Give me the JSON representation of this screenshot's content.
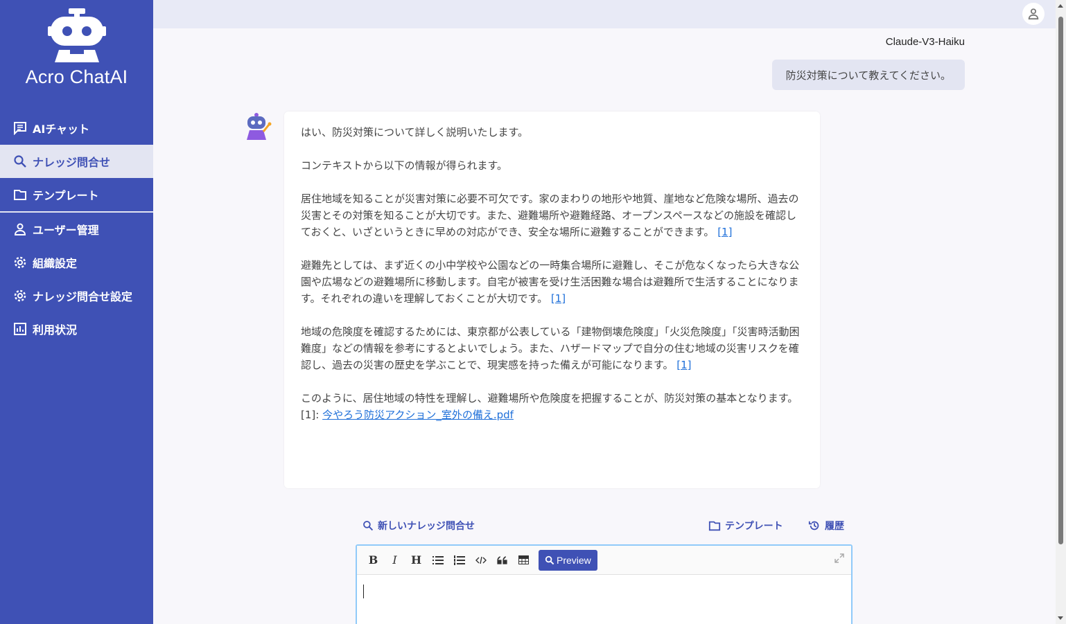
{
  "app": {
    "name": "Acro ChatAI"
  },
  "sidebar": {
    "items": [
      {
        "label": "AIチャット",
        "icon": "chat-icon"
      },
      {
        "label": "ナレッジ問合せ",
        "icon": "search-icon",
        "active": true
      },
      {
        "label": "テンプレート",
        "icon": "folder-icon"
      },
      {
        "label": "ユーザー管理",
        "icon": "user-icon"
      },
      {
        "label": "組織設定",
        "icon": "gear-icon"
      },
      {
        "label": "ナレッジ問合せ設定",
        "icon": "gear-icon"
      },
      {
        "label": "利用状況",
        "icon": "bar-chart-icon"
      }
    ]
  },
  "chat": {
    "model": "Claude-V3-Haiku",
    "user_message": "防災対策について教えてください。",
    "bot": {
      "p1": "はい、防災対策について詳しく説明いたします。",
      "p2": "コンテキストから以下の情報が得られます。",
      "p3": "居住地域を知ることが災害対策に必要不可欠です。家のまわりの地形や地質、崖地など危険な場所、過去の災害とその対策を知ることが大切です。また、避難場所や避難経路、オープンスペースなどの施設を確認しておくと、いざというときに早めの対応ができ、安全な場所に避難することができます。",
      "p4": "避難先としては、まず近くの小中学校や公園などの一時集合場所に避難し、そこが危なくなったら大きな公園や広場などの避難場所に移動します。自宅が被害を受け生活困難な場合は避難所で生活することになります。それぞれの違いを理解しておくことが大切です。",
      "p5": "地域の危険度を確認するためには、東京都が公表している「建物倒壊危険度」「火災危険度」「災害時活動困難度」などの情報を参考にするとよいでしょう。また、ハザードマップで自分の住む地域の災害リスクを確認し、過去の災害の歴史を学ぶことで、現実感を持った備えが可能になります。",
      "p6": "このように、居住地域の特性を理解し、避難場所や危険度を把握することが、防災対策の基本となります。",
      "ref_marker": "[1]",
      "ref_label": "[1]:",
      "ref_file": "今やろう防災アクション_室外の備え.pdf"
    }
  },
  "actions": {
    "new_query": "新しいナレッジ問合せ",
    "template": "テンプレート",
    "history": "履歴"
  },
  "editor": {
    "toolbar": [
      "bold",
      "italic",
      "heading",
      "bulleted-list",
      "numbered-list",
      "code",
      "quote",
      "table"
    ],
    "bold_label": "B",
    "italic_label": "I",
    "heading_label": "H",
    "preview_label": "Preview",
    "value": ""
  },
  "colors": {
    "primary": "#3f51b5",
    "active_bg": "#e3e5f2",
    "link": "#1e6fd9"
  }
}
